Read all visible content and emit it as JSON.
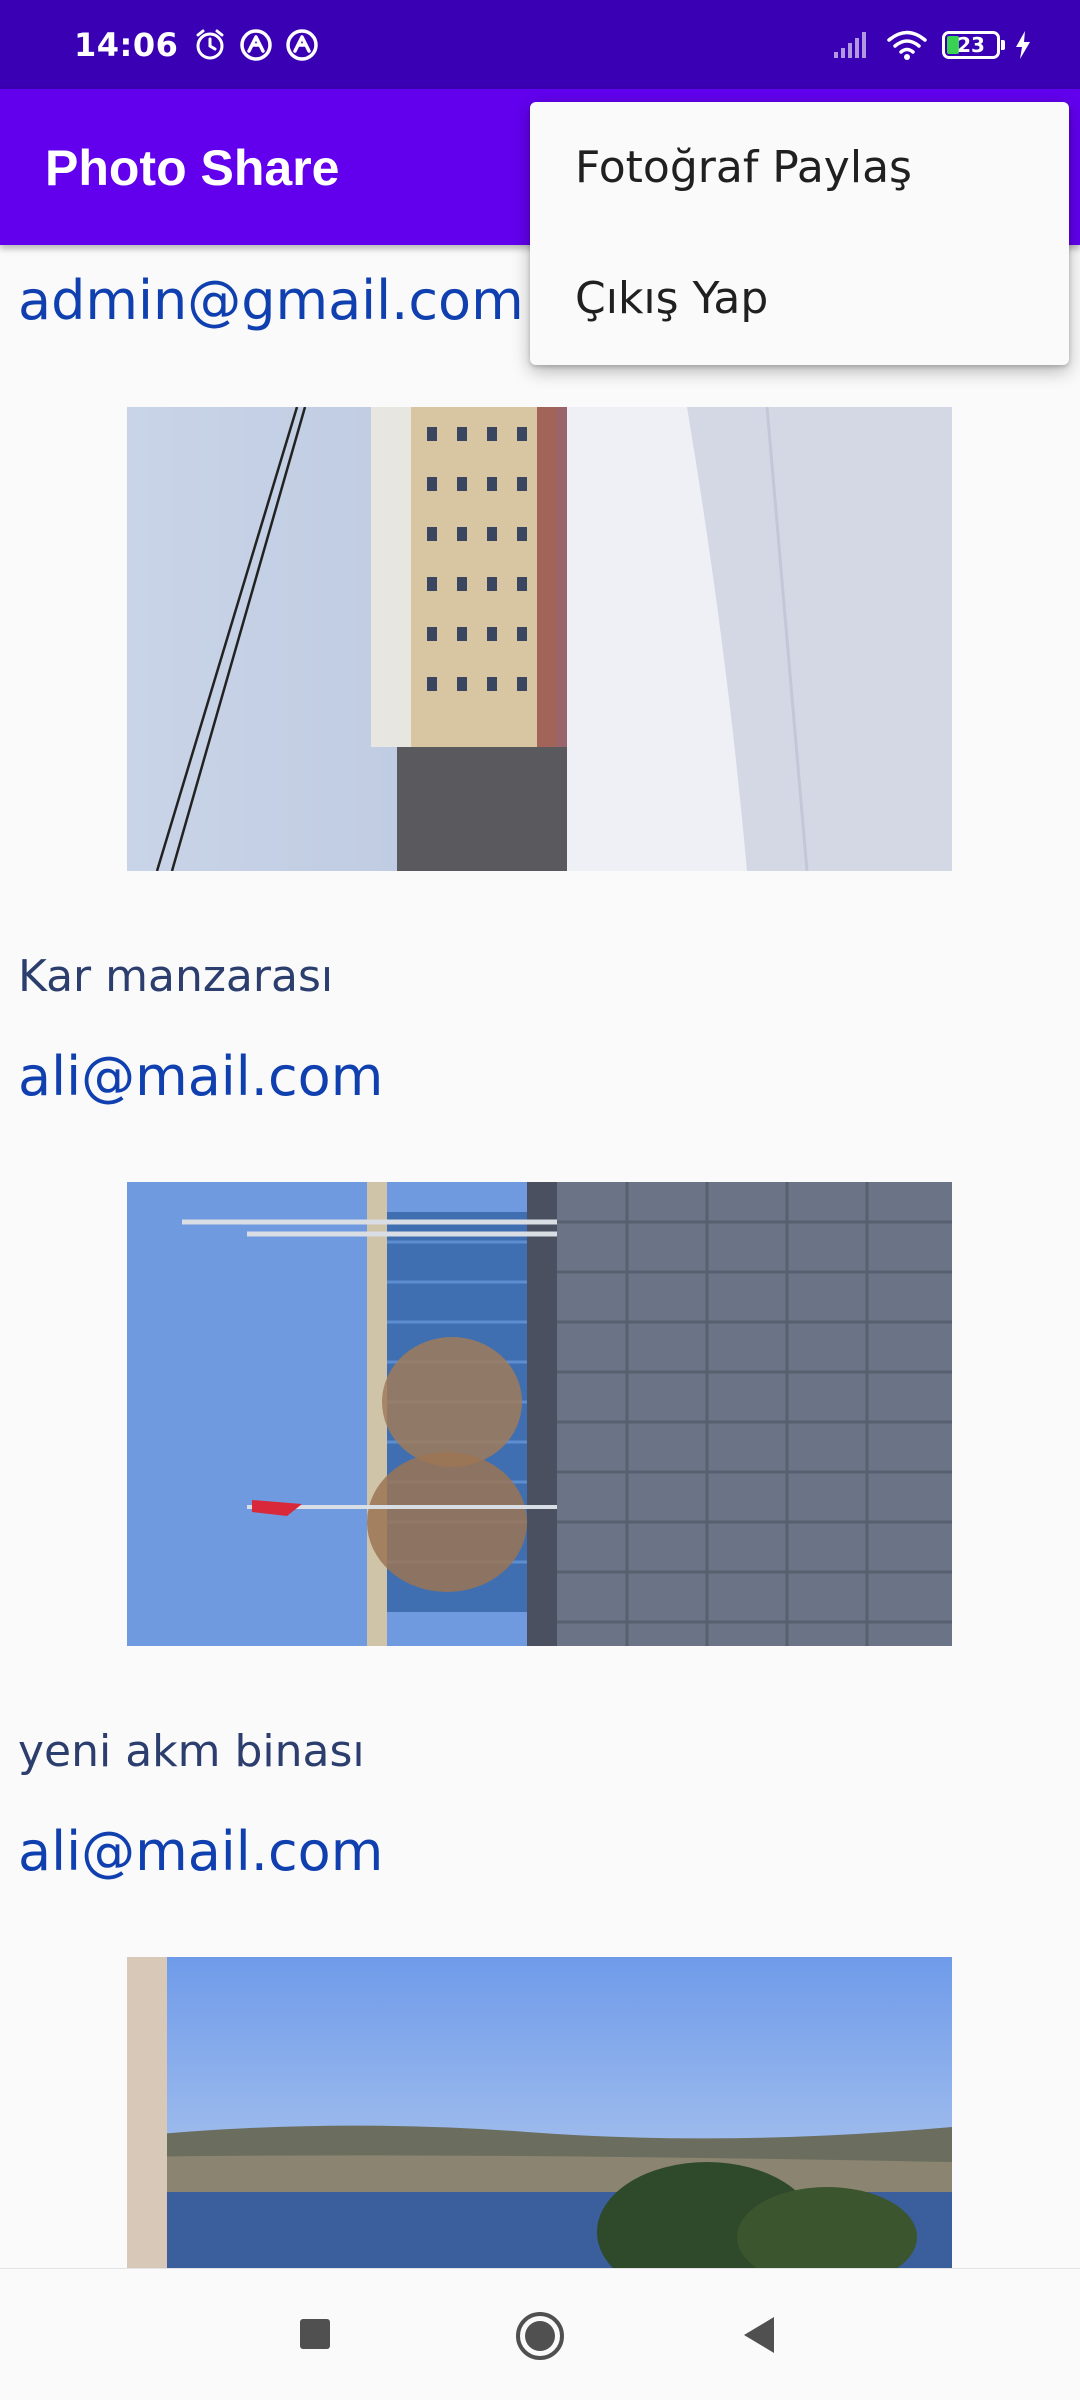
{
  "status_bar": {
    "time": "14:06",
    "battery_level": "23",
    "icons": [
      "alarm-icon",
      "app-notification-icon",
      "app-notification-icon",
      "signal-icon",
      "wifi-icon",
      "battery-icon",
      "charging-icon"
    ]
  },
  "app_bar": {
    "title": "Photo Share",
    "background": "#6200ee"
  },
  "menu": {
    "items": [
      {
        "label": "Fotoğraf Paylaş"
      },
      {
        "label": "Çıkış Yap"
      }
    ]
  },
  "feed": {
    "posts": [
      {
        "email": "admin@gmail.com",
        "caption": "Kar manzarası",
        "photo": "snowy building street photo"
      },
      {
        "email": "ali@mail.com",
        "caption": "yeni akm binası",
        "photo": "blue glass building with flags photo"
      },
      {
        "email": "ali@mail.com",
        "caption": "",
        "photo": "bosphorus sea view photo"
      }
    ]
  },
  "nav_bar": {
    "icons": [
      "recents-square-icon",
      "home-circle-icon",
      "back-triangle-icon"
    ]
  },
  "colors": {
    "status_bar": "#3a00b3",
    "email_text": "#1040b0",
    "caption_text": "#2c3e6e",
    "background": "#fafafa"
  }
}
